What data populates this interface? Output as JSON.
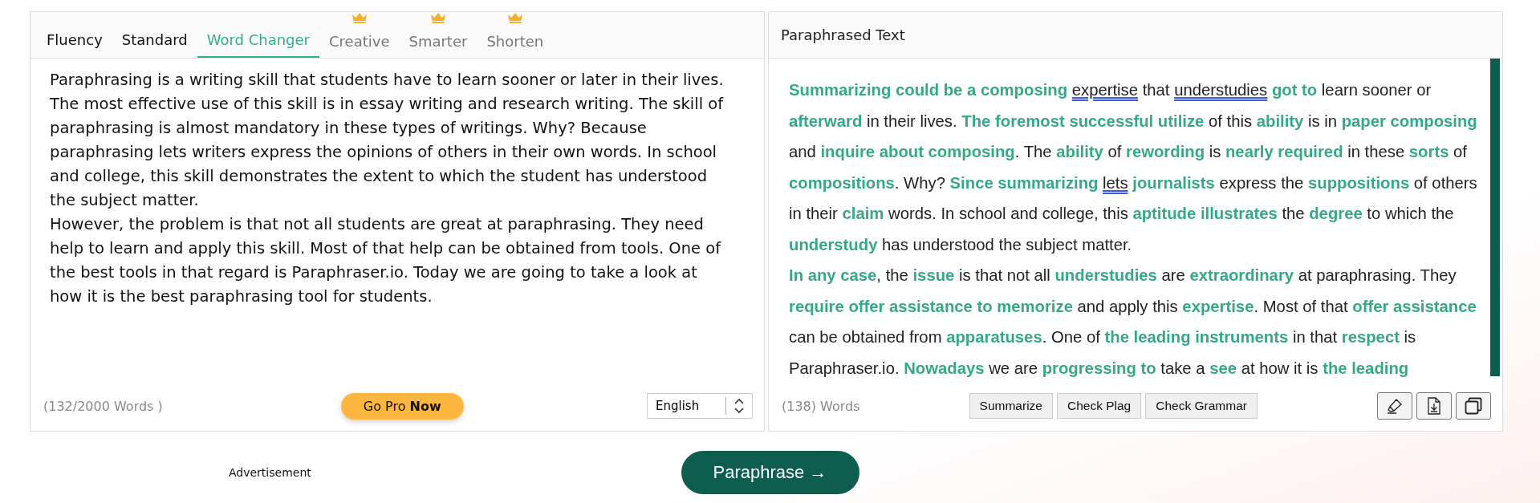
{
  "input_panel": {
    "tabs": [
      {
        "label": "Fluency",
        "selected": false,
        "premium": false
      },
      {
        "label": "Standard",
        "selected": false,
        "premium": false
      },
      {
        "label": "Word Changer",
        "selected": true,
        "premium": false
      },
      {
        "label": "Creative",
        "selected": false,
        "premium": true
      },
      {
        "label": "Smarter",
        "selected": false,
        "premium": true
      },
      {
        "label": "Shorten",
        "selected": false,
        "premium": true
      }
    ],
    "paragraphs": [
      "Paraphrasing is a writing skill that students have to learn sooner or later in their lives. The most effective use of this skill is in essay writing and research writing. The skill of paraphrasing is almost mandatory in these types of writings. Why? Because paraphrasing lets writers express the opinions of others in their own words. In school and college, this skill demonstrates the extent to which the student has understood the subject matter.",
      "However, the problem is that not all students are great at paraphrasing. They need help to learn and apply this skill. Most of that help can be obtained from tools. One of the best tools in that regard is Paraphraser.io. Today we are going to take a look at how it is the best paraphrasing tool for students."
    ],
    "word_count": "(132/2000 Words )",
    "pro_button": "Go Pro **Now**",
    "language": "English"
  },
  "output_panel": {
    "title": "Paraphrased Text",
    "paragraphs": [
      [
        {
          "kind": "changed",
          "text": "Summarizing could be a composing "
        },
        {
          "kind": "flagged",
          "text": "expertise"
        },
        {
          "kind": "plain",
          "text": " that "
        },
        {
          "kind": "flagged",
          "text": "understudies"
        },
        {
          "kind": "changed",
          "text": " got to"
        },
        {
          "kind": "plain",
          "text": " learn sooner or "
        },
        {
          "kind": "changed",
          "text": "afterward"
        },
        {
          "kind": "plain",
          "text": " in their lives. "
        },
        {
          "kind": "changed",
          "text": "The foremost successful utilize"
        },
        {
          "kind": "plain",
          "text": " of this "
        },
        {
          "kind": "changed",
          "text": "ability"
        },
        {
          "kind": "plain",
          "text": " is in "
        },
        {
          "kind": "changed",
          "text": "paper composing"
        },
        {
          "kind": "plain",
          "text": " and "
        },
        {
          "kind": "changed",
          "text": "inquire about composing"
        },
        {
          "kind": "plain",
          "text": ". The "
        },
        {
          "kind": "changed",
          "text": "ability"
        },
        {
          "kind": "plain",
          "text": " of "
        },
        {
          "kind": "changed",
          "text": "rewording"
        },
        {
          "kind": "plain",
          "text": " is "
        },
        {
          "kind": "changed",
          "text": "nearly required"
        },
        {
          "kind": "plain",
          "text": " in these "
        },
        {
          "kind": "changed",
          "text": "sorts"
        },
        {
          "kind": "plain",
          "text": " of "
        },
        {
          "kind": "changed",
          "text": "compositions"
        },
        {
          "kind": "plain",
          "text": ". Why? "
        },
        {
          "kind": "changed",
          "text": "Since summarizing "
        },
        {
          "kind": "flagged",
          "text": "lets"
        },
        {
          "kind": "changed",
          "text": " journalists"
        },
        {
          "kind": "plain",
          "text": " express the "
        },
        {
          "kind": "changed",
          "text": "suppositions"
        },
        {
          "kind": "plain",
          "text": " of others in their "
        },
        {
          "kind": "changed",
          "text": "claim"
        },
        {
          "kind": "plain",
          "text": " words. In school and college, this "
        },
        {
          "kind": "changed",
          "text": "aptitude illustrates"
        },
        {
          "kind": "plain",
          "text": " the "
        },
        {
          "kind": "changed",
          "text": "degree"
        },
        {
          "kind": "plain",
          "text": " to which the "
        },
        {
          "kind": "changed",
          "text": "understudy"
        },
        {
          "kind": "plain",
          "text": " has understood the subject matter."
        }
      ],
      [
        {
          "kind": "changed",
          "text": "In any case"
        },
        {
          "kind": "plain",
          "text": ", the "
        },
        {
          "kind": "changed",
          "text": "issue"
        },
        {
          "kind": "plain",
          "text": " is that not all "
        },
        {
          "kind": "changed",
          "text": "understudies"
        },
        {
          "kind": "plain",
          "text": " are "
        },
        {
          "kind": "changed",
          "text": "extraordinary"
        },
        {
          "kind": "plain",
          "text": " at paraphrasing. They "
        },
        {
          "kind": "changed",
          "text": "require offer assistance to memorize"
        },
        {
          "kind": "plain",
          "text": " and apply this "
        },
        {
          "kind": "changed",
          "text": "expertise"
        },
        {
          "kind": "plain",
          "text": ". Most of that "
        },
        {
          "kind": "changed",
          "text": "offer assistance"
        },
        {
          "kind": "plain",
          "text": " can be obtained from "
        },
        {
          "kind": "changed",
          "text": "apparatuses"
        },
        {
          "kind": "plain",
          "text": ". One of "
        },
        {
          "kind": "changed",
          "text": "the leading instruments"
        },
        {
          "kind": "plain",
          "text": " in that "
        },
        {
          "kind": "changed",
          "text": "respect"
        },
        {
          "kind": "plain",
          "text": " is Paraphraser.io. "
        },
        {
          "kind": "changed",
          "text": "Nowadays"
        },
        {
          "kind": "plain",
          "text": " we are "
        },
        {
          "kind": "changed",
          "text": "progressing to"
        },
        {
          "kind": "plain",
          "text": " take a "
        },
        {
          "kind": "changed",
          "text": "see"
        },
        {
          "kind": "plain",
          "text": " at how it is "
        },
        {
          "kind": "changed",
          "text": "the leading"
        }
      ]
    ],
    "word_count": "(138) Words",
    "buttons": [
      "Summarize",
      "Check Plag",
      "Check Grammar"
    ]
  },
  "advertisement": "Advertisement",
  "paraphrase_button": "Paraphrase →"
}
